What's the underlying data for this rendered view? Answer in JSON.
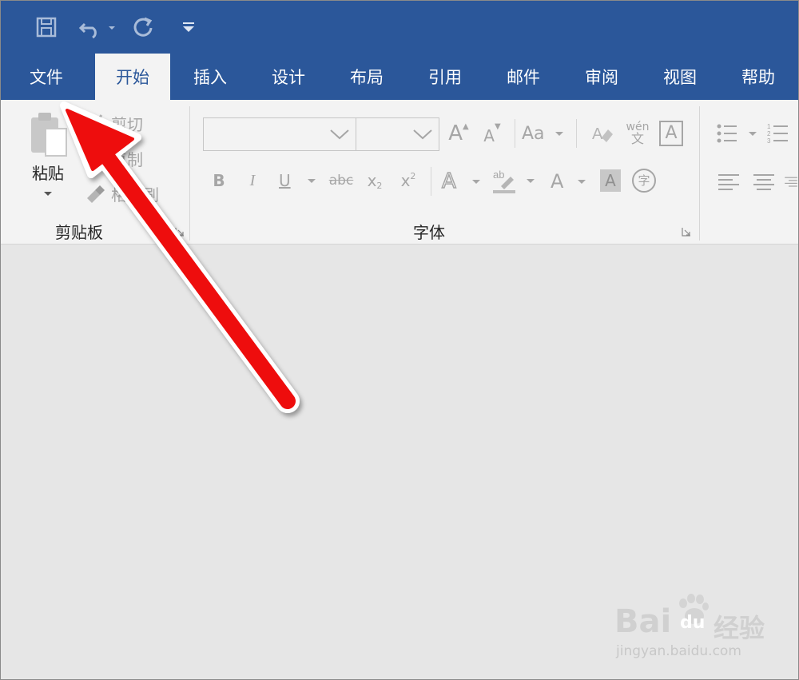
{
  "tabs": [
    {
      "label": "文件"
    },
    {
      "label": "开始",
      "active": true
    },
    {
      "label": "插入"
    },
    {
      "label": "设计"
    },
    {
      "label": "布局"
    },
    {
      "label": "引用"
    },
    {
      "label": "邮件"
    },
    {
      "label": "审阅"
    },
    {
      "label": "视图"
    },
    {
      "label": "帮助"
    }
  ],
  "clipboard": {
    "paste": "粘贴",
    "cut": "剪切",
    "copy": "复制",
    "format_painter": "格式刷",
    "group_label": "剪贴板"
  },
  "font": {
    "group_label": "字体",
    "font_name": "",
    "font_size": "",
    "case_label": "Aa",
    "phonetic_top": "wén",
    "phonetic_bottom": "文",
    "enclose_char": "字",
    "bold": "B",
    "italic": "I",
    "underline": "U",
    "strike": "abc",
    "sub": "x",
    "sup": "x",
    "grow": "A",
    "shrink": "A",
    "color_a": "A",
    "shade_a": "A",
    "border_a": "A"
  },
  "watermark": {
    "brand": "Bai",
    "brand_cn": "经验",
    "url": "jingyan.baidu.com"
  },
  "colors": {
    "title_bar": "#2b579a",
    "ribbon": "#f3f3f3",
    "document": "#e6e6e6",
    "arrow": "#ee1111"
  },
  "icons": [
    "save-icon",
    "undo-icon",
    "redo-icon",
    "customize-qat-icon",
    "paste-icon",
    "cut-icon",
    "copy-icon",
    "format-painter-icon",
    "clear-format-icon",
    "bullets-icon",
    "numbering-icon",
    "align-left-icon",
    "align-center-icon",
    "align-right-icon",
    "red-arrow-annotation"
  ]
}
